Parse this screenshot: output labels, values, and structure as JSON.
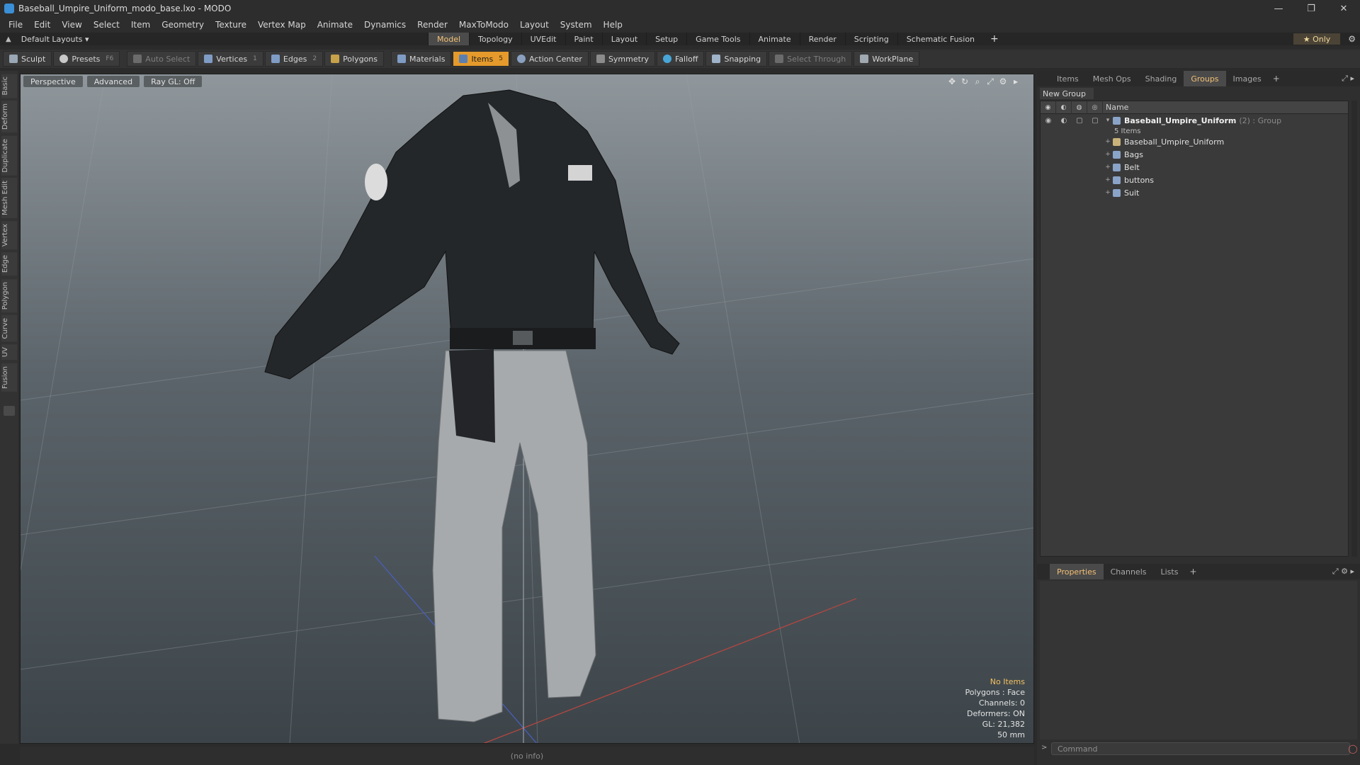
{
  "window": {
    "title": "Baseball_Umpire_Uniform_modo_base.lxo - MODO",
    "minimize": "—",
    "restore": "❐",
    "close": "✕"
  },
  "menu": [
    "File",
    "Edit",
    "View",
    "Select",
    "Item",
    "Geometry",
    "Texture",
    "Vertex Map",
    "Animate",
    "Dynamics",
    "Render",
    "MaxToModo",
    "Layout",
    "System",
    "Help"
  ],
  "layoutbar": {
    "layouts_label": "Default Layouts ▾",
    "tabs": [
      "Model",
      "Topology",
      "UVEdit",
      "Paint",
      "Layout",
      "Setup",
      "Game Tools",
      "Animate",
      "Render",
      "Scripting",
      "Schematic Fusion"
    ],
    "active_tab": "Model",
    "plus": "+",
    "only_label": "★  Only"
  },
  "toolbar": {
    "sculpt": "Sculpt",
    "presets": "Presets",
    "presets_key": "F6",
    "auto_select": "Auto Select",
    "vertices": "Vertices",
    "vertices_key": "1",
    "edges": "Edges",
    "edges_key": "2",
    "polygons": "Polygons",
    "materials": "Materials",
    "items": "Items",
    "items_key": "5",
    "action_center": "Action Center",
    "symmetry": "Symmetry",
    "falloff": "Falloff",
    "snapping": "Snapping",
    "select_through": "Select Through",
    "workplane": "WorkPlane"
  },
  "left_tabs": [
    "Basic",
    "Deform",
    "Duplicate",
    "Mesh Edit",
    "Vertex",
    "Edge",
    "Polygon",
    "Curve",
    "UV",
    "Fusion"
  ],
  "viewport": {
    "view": "Perspective",
    "shading": "Advanced",
    "raygl": "Ray GL: Off",
    "info": {
      "no_items": "No Items",
      "polygons": "Polygons : Face",
      "channels": "Channels: 0",
      "deformers": "Deformers: ON",
      "gl": "GL: 21,382",
      "focal": "50 mm"
    }
  },
  "status": "(no info)",
  "groups_panel": {
    "tabs": [
      "Items",
      "Mesh Ops",
      "Shading",
      "Groups",
      "Images"
    ],
    "active_tab": "Groups",
    "new_group": "New Group",
    "name_header": "Name",
    "group": {
      "label": "Baseball_Umpire_Uniform",
      "meta": "(2) : Group",
      "count": "5 Items"
    },
    "children": [
      "Baseball_Umpire_Uniform",
      "Bags",
      "Belt",
      "buttons",
      "Suit"
    ]
  },
  "properties_panel": {
    "tabs": [
      "Properties",
      "Channels",
      "Lists"
    ],
    "active_tab": "Properties",
    "command_placeholder": "Command"
  },
  "colors": {
    "accent": "#e59a2b",
    "active_tab_text": "#f3c074",
    "background": "#2b2b2b"
  }
}
